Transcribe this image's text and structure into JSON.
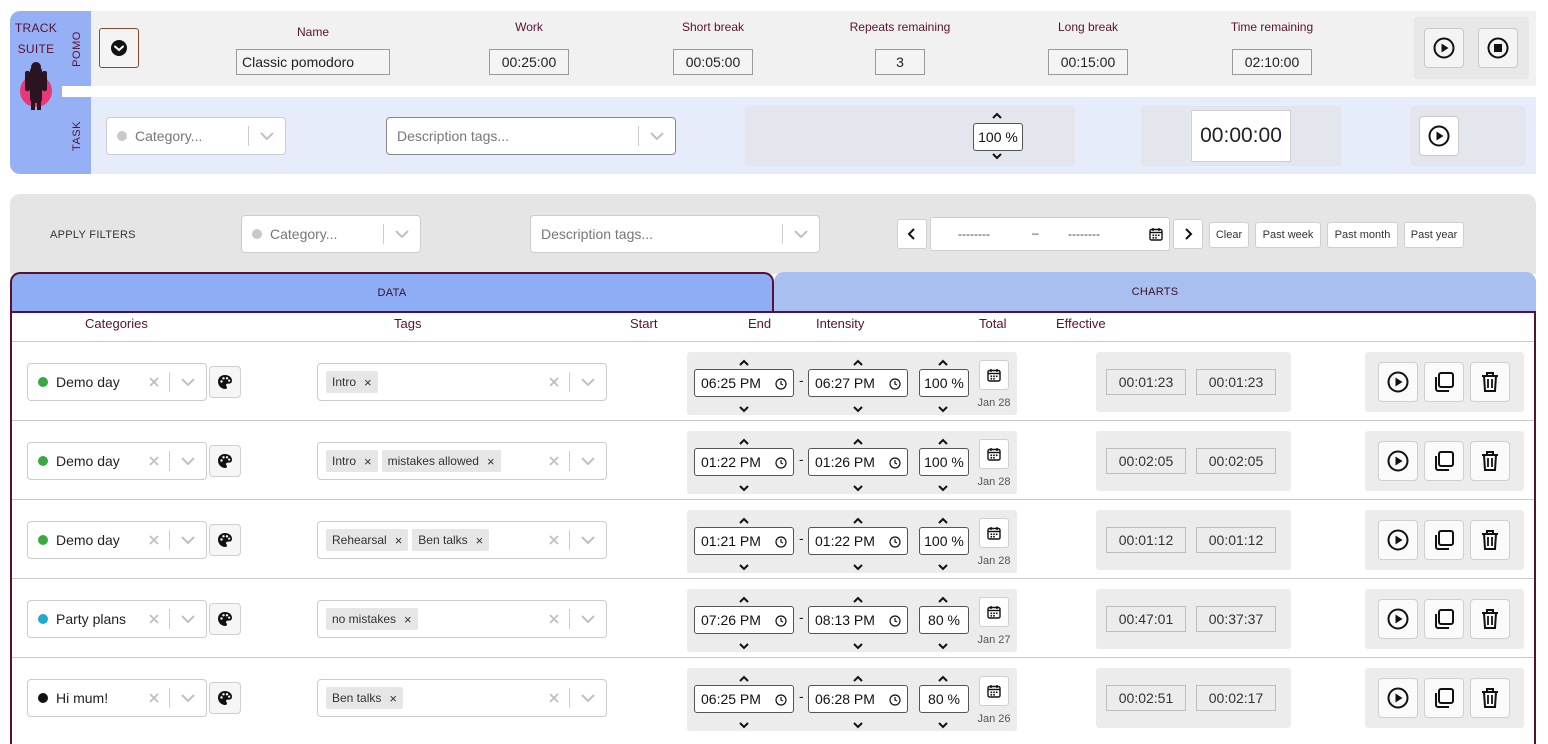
{
  "logo": {
    "line1": "TRACK",
    "line2": "SUITE"
  },
  "sections": {
    "pomo": "POMO",
    "task": "TASK"
  },
  "pomo": {
    "labels": {
      "name": "Name",
      "work": "Work",
      "short_break": "Short break",
      "repeats": "Repeats remaining",
      "long_break": "Long break",
      "time_remaining": "Time remaining"
    },
    "values": {
      "name": "Classic pomodoro",
      "work": "00:25:00",
      "short_break": "00:05:00",
      "repeats": "3",
      "long_break": "00:15:00",
      "time_remaining": "02:10:00"
    }
  },
  "task": {
    "category_placeholder": "Category...",
    "tags_placeholder": "Description tags...",
    "intensity": "100 %",
    "timer": "00:00:00"
  },
  "filters": {
    "label": "APPLY FILTERS",
    "category_placeholder": "Category...",
    "tags_placeholder": "Description tags...",
    "date_from": "--------",
    "date_sep": "–",
    "date_to": "--------",
    "clear": "Clear",
    "past_week": "Past week",
    "past_month": "Past month",
    "past_year": "Past year"
  },
  "tabs": {
    "data": "DATA",
    "charts": "CHARTS"
  },
  "columns": {
    "categories": "Categories",
    "tags": "Tags",
    "start": "Start",
    "end": "End",
    "intensity": "Intensity",
    "total": "Total",
    "effective": "Effective"
  },
  "rows": [
    {
      "category": "Demo day",
      "dot_color": "#3aa845",
      "tags": [
        "Intro"
      ],
      "start": "06:25 PM",
      "end": "06:27 PM",
      "intensity": "100 %",
      "date": "Jan 28",
      "total": "00:01:23",
      "effective": "00:01:23"
    },
    {
      "category": "Demo day",
      "dot_color": "#3aa845",
      "tags": [
        "Intro",
        "mistakes allowed"
      ],
      "start": "01:22 PM",
      "end": "01:26 PM",
      "intensity": "100 %",
      "date": "Jan 28",
      "total": "00:02:05",
      "effective": "00:02:05"
    },
    {
      "category": "Demo day",
      "dot_color": "#3aa845",
      "tags": [
        "Rehearsal",
        "Ben talks"
      ],
      "start": "01:21 PM",
      "end": "01:22 PM",
      "intensity": "100 %",
      "date": "Jan 28",
      "total": "00:01:12",
      "effective": "00:01:12"
    },
    {
      "category": "Party plans",
      "dot_color": "#22a7cf",
      "tags": [
        "no mistakes"
      ],
      "start": "07:26 PM",
      "end": "08:13 PM",
      "intensity": "80 %",
      "date": "Jan 27",
      "total": "00:47:01",
      "effective": "00:37:37"
    },
    {
      "category": "Hi mum!",
      "dot_color": "#111111",
      "tags": [
        "Ben talks"
      ],
      "start": "06:25 PM",
      "end": "06:28 PM",
      "intensity": "80 %",
      "date": "Jan 26",
      "total": "00:02:51",
      "effective": "00:02:17"
    }
  ]
}
